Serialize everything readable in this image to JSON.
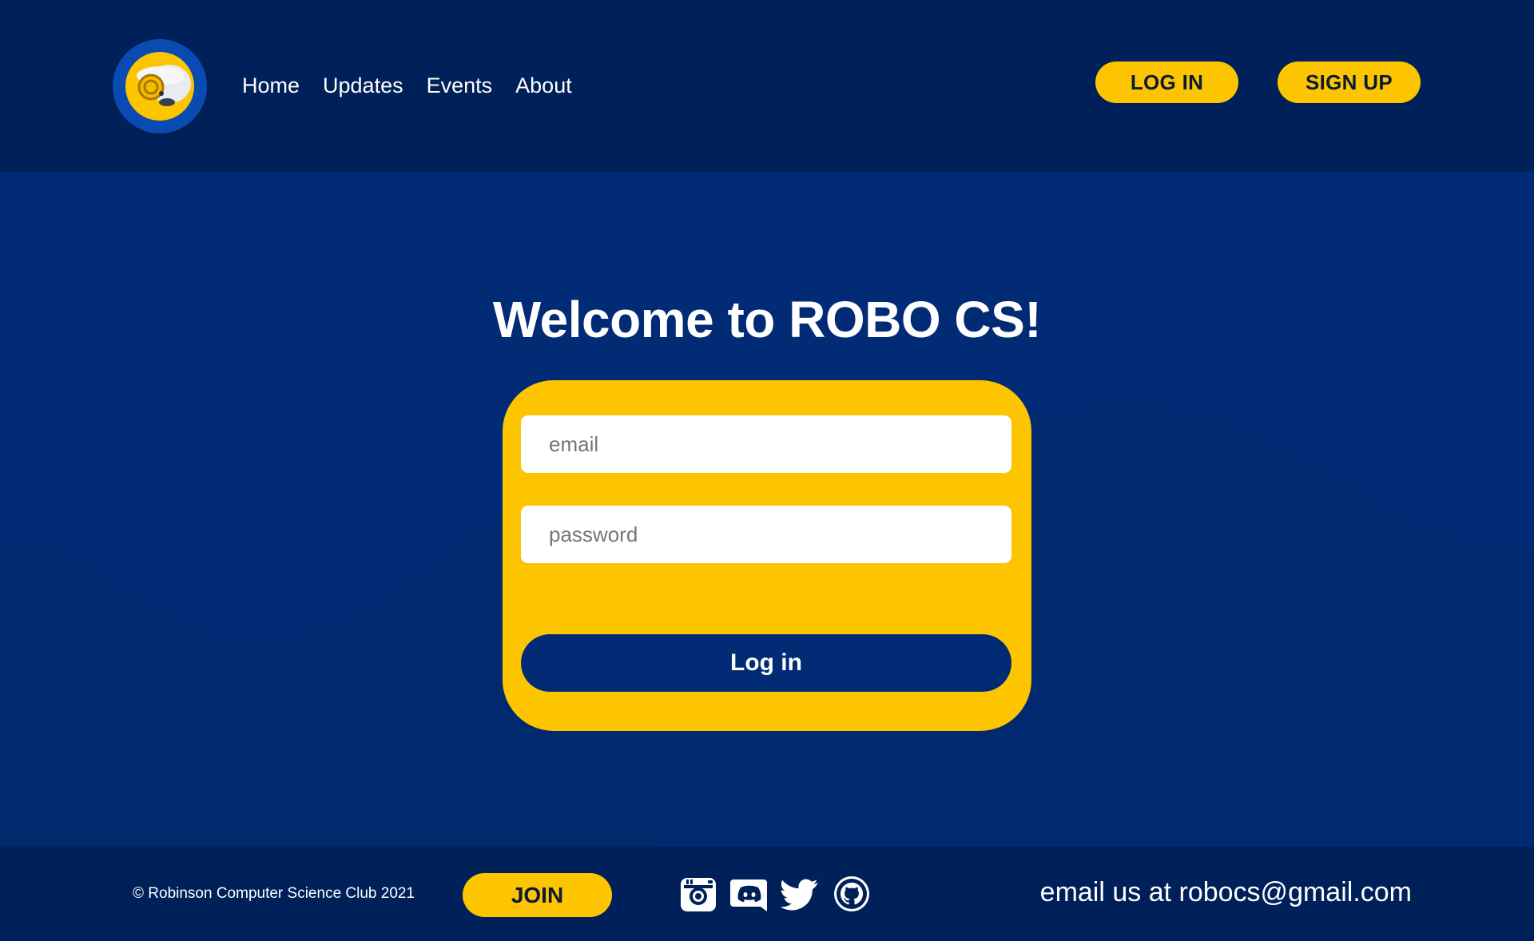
{
  "header": {
    "logo_alt": "ROBO CS ram logo",
    "nav": [
      {
        "label": "Home"
      },
      {
        "label": "Updates"
      },
      {
        "label": "Events"
      },
      {
        "label": "About"
      }
    ],
    "login_label": "LOG IN",
    "signup_label": "SIGN UP"
  },
  "main": {
    "title": "Welcome to ROBO CS!",
    "form": {
      "email_placeholder": "email",
      "password_placeholder": "password",
      "submit_label": "Log in"
    }
  },
  "footer": {
    "copyright": "© Robinson Computer Science Club 2021",
    "join_label": "JOIN",
    "socials": [
      {
        "icon": "instagram-icon"
      },
      {
        "icon": "discord-icon"
      },
      {
        "icon": "twitter-icon"
      },
      {
        "icon": "github-icon"
      }
    ],
    "email_text": "email us at robocs@gmail.com"
  },
  "colors": {
    "header_bg": "#00205a",
    "main_bg": "#022b75",
    "accent": "#fdc500",
    "text_light": "#ffffff"
  }
}
